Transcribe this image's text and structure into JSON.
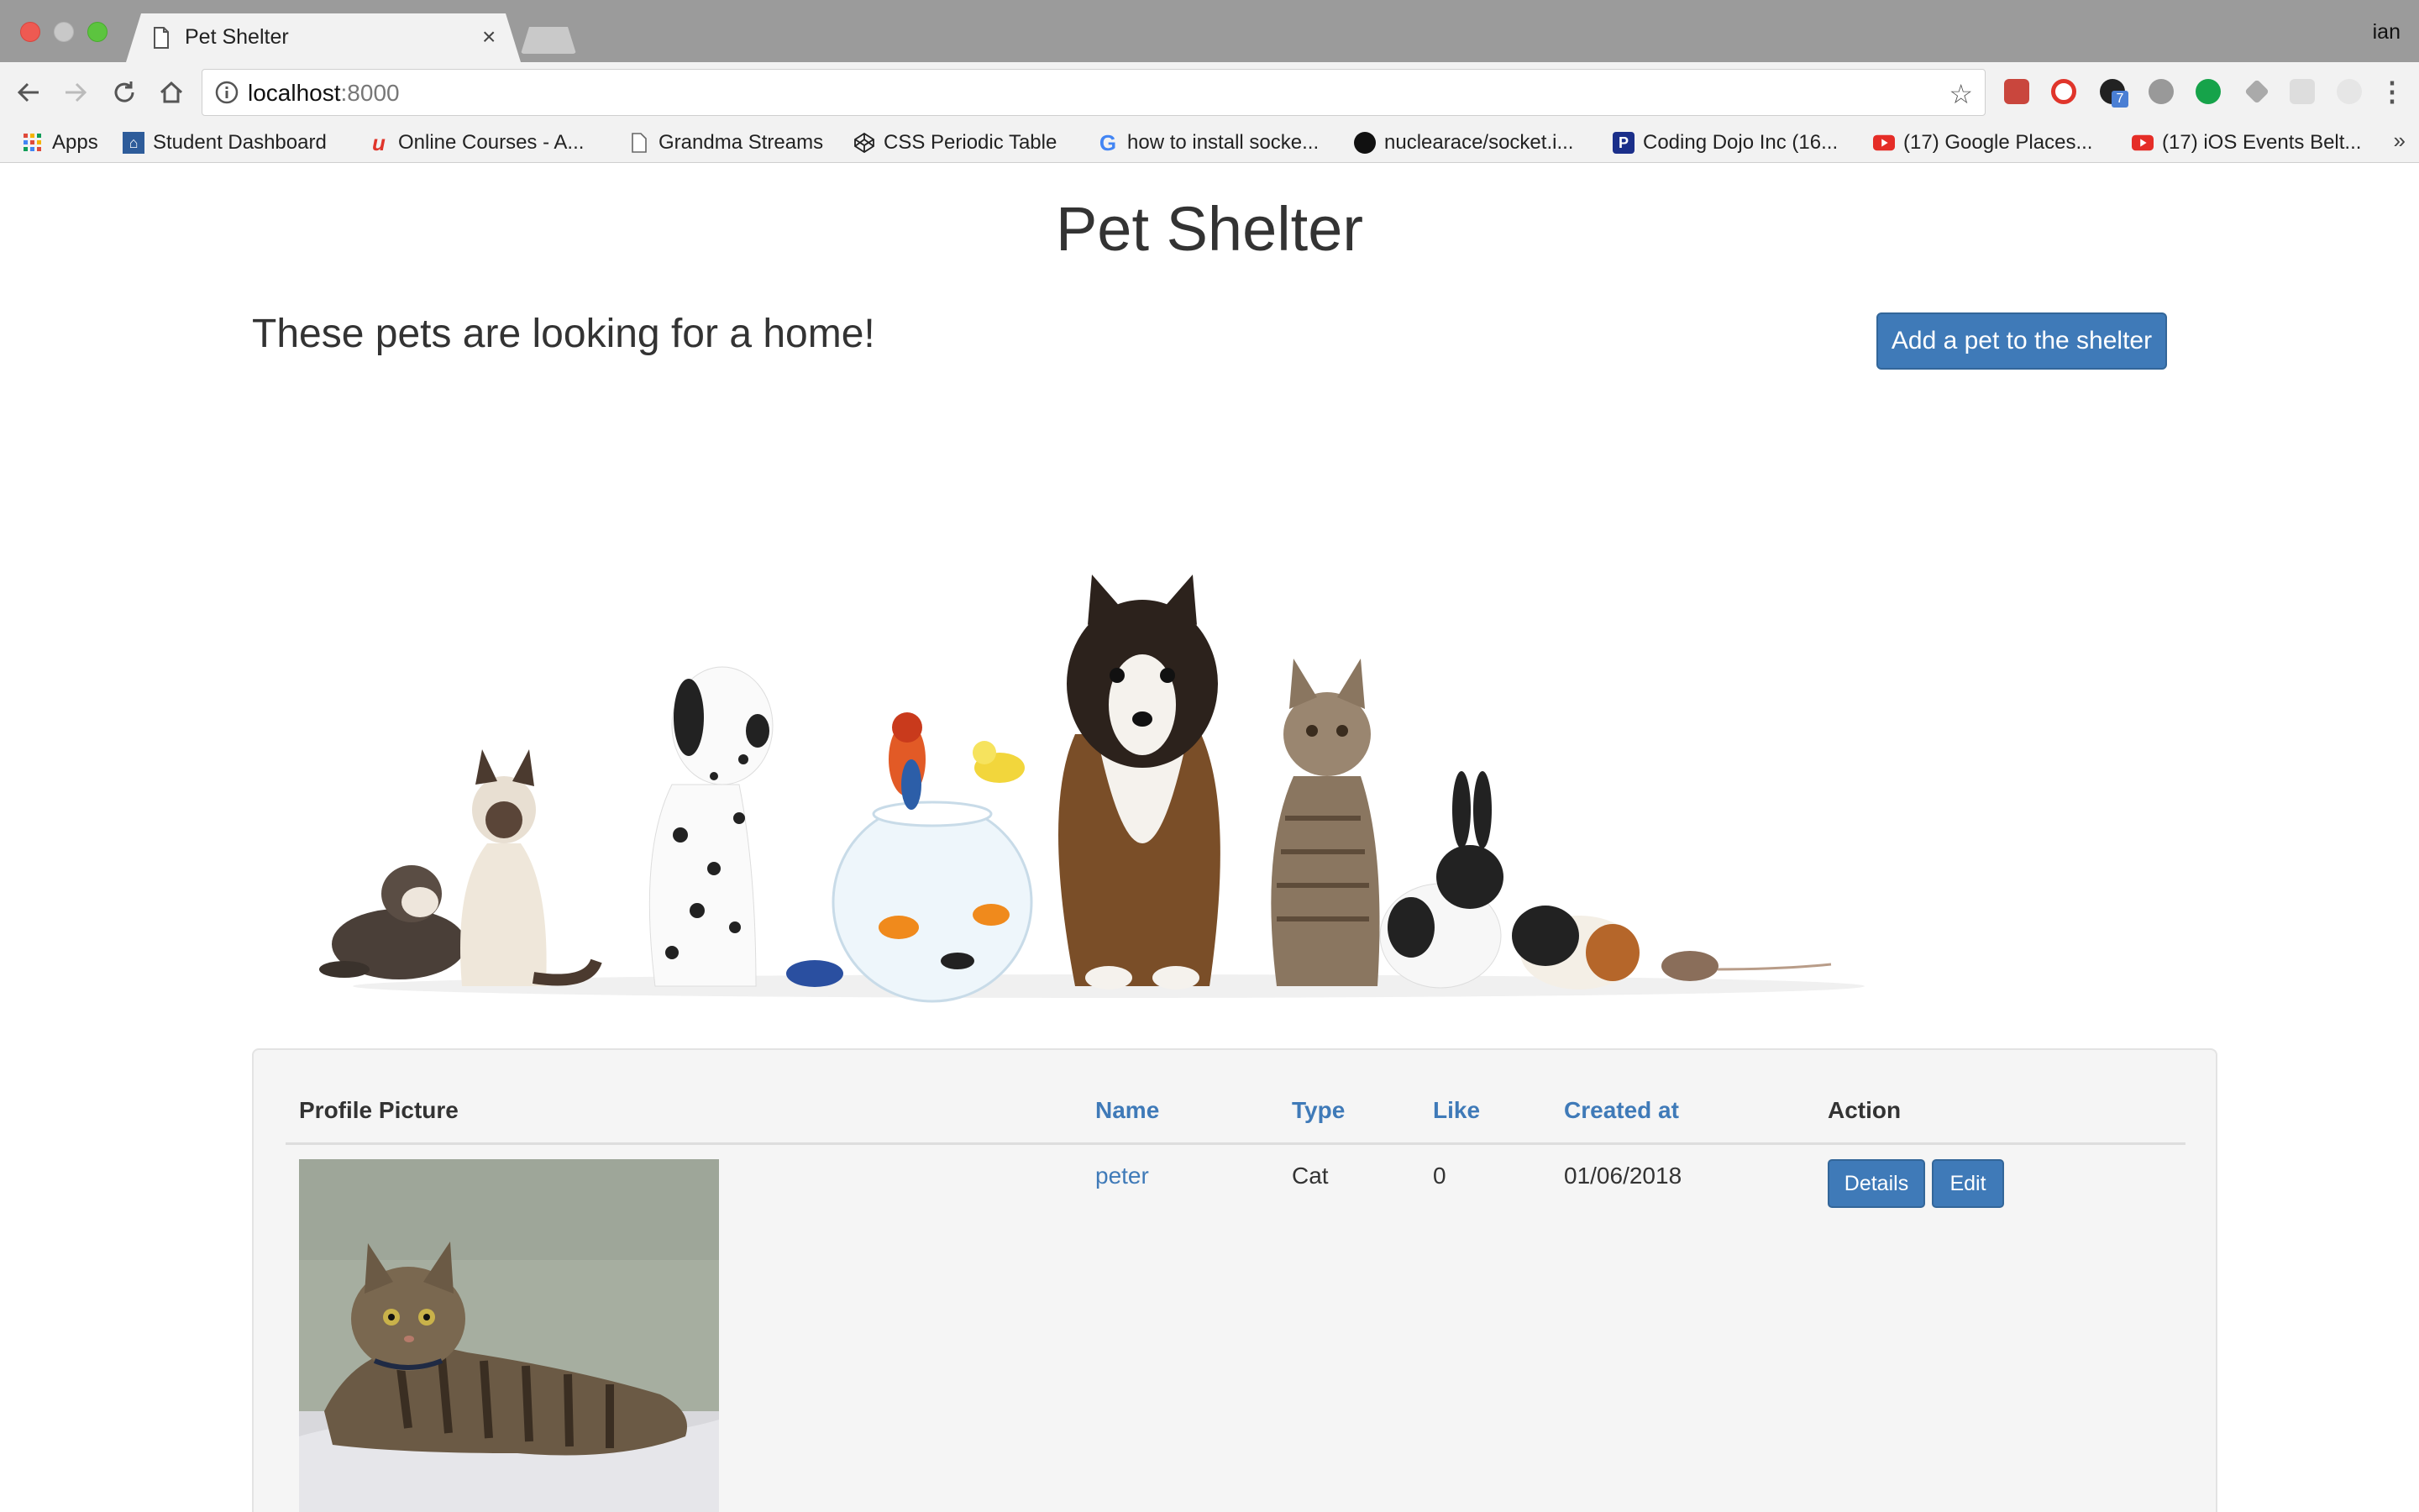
{
  "browser": {
    "tab_title": "Pet Shelter",
    "tab_close": "×",
    "profile_name": "ian",
    "url_host": "localhost",
    "url_port": ":8000",
    "bookmarks": [
      {
        "label": "Apps",
        "icon": "apps-grid-icon"
      },
      {
        "label": "Student Dashboard",
        "icon": "dashboard-icon"
      },
      {
        "label": "Online Courses - A...",
        "icon": "udemy-icon"
      },
      {
        "label": "Grandma Streams",
        "icon": "page-icon"
      },
      {
        "label": "CSS Periodic Table",
        "icon": "codepen-icon"
      },
      {
        "label": "how to install socke...",
        "icon": "google-icon"
      },
      {
        "label": "nuclearace/socket.i...",
        "icon": "github-icon"
      },
      {
        "label": "Coding Dojo Inc (16...",
        "icon": "paypal-icon"
      },
      {
        "label": "(17) Google Places...",
        "icon": "youtube-icon"
      },
      {
        "label": "(17) iOS Events Belt...",
        "icon": "youtube-icon"
      }
    ],
    "bookmarks_more": "»",
    "extension_badge": "7"
  },
  "page": {
    "title": "Pet Shelter",
    "subtitle": "These pets are looking for a home!",
    "add_button": "Add a pet to the shelter"
  },
  "table": {
    "headers": {
      "profile_picture": "Profile Picture",
      "name": "Name",
      "type": "Type",
      "like": "Like",
      "created_at": "Created at",
      "action": "Action"
    },
    "rows": [
      {
        "name": "peter",
        "type": "Cat",
        "like": "0",
        "created_at": "01/06/2018",
        "details_label": "Details",
        "edit_label": "Edit"
      }
    ]
  },
  "colors": {
    "primary": "#3f7ab8",
    "panel_bg": "#f5f5f5",
    "chrome_gray": "#9b9b9b"
  }
}
